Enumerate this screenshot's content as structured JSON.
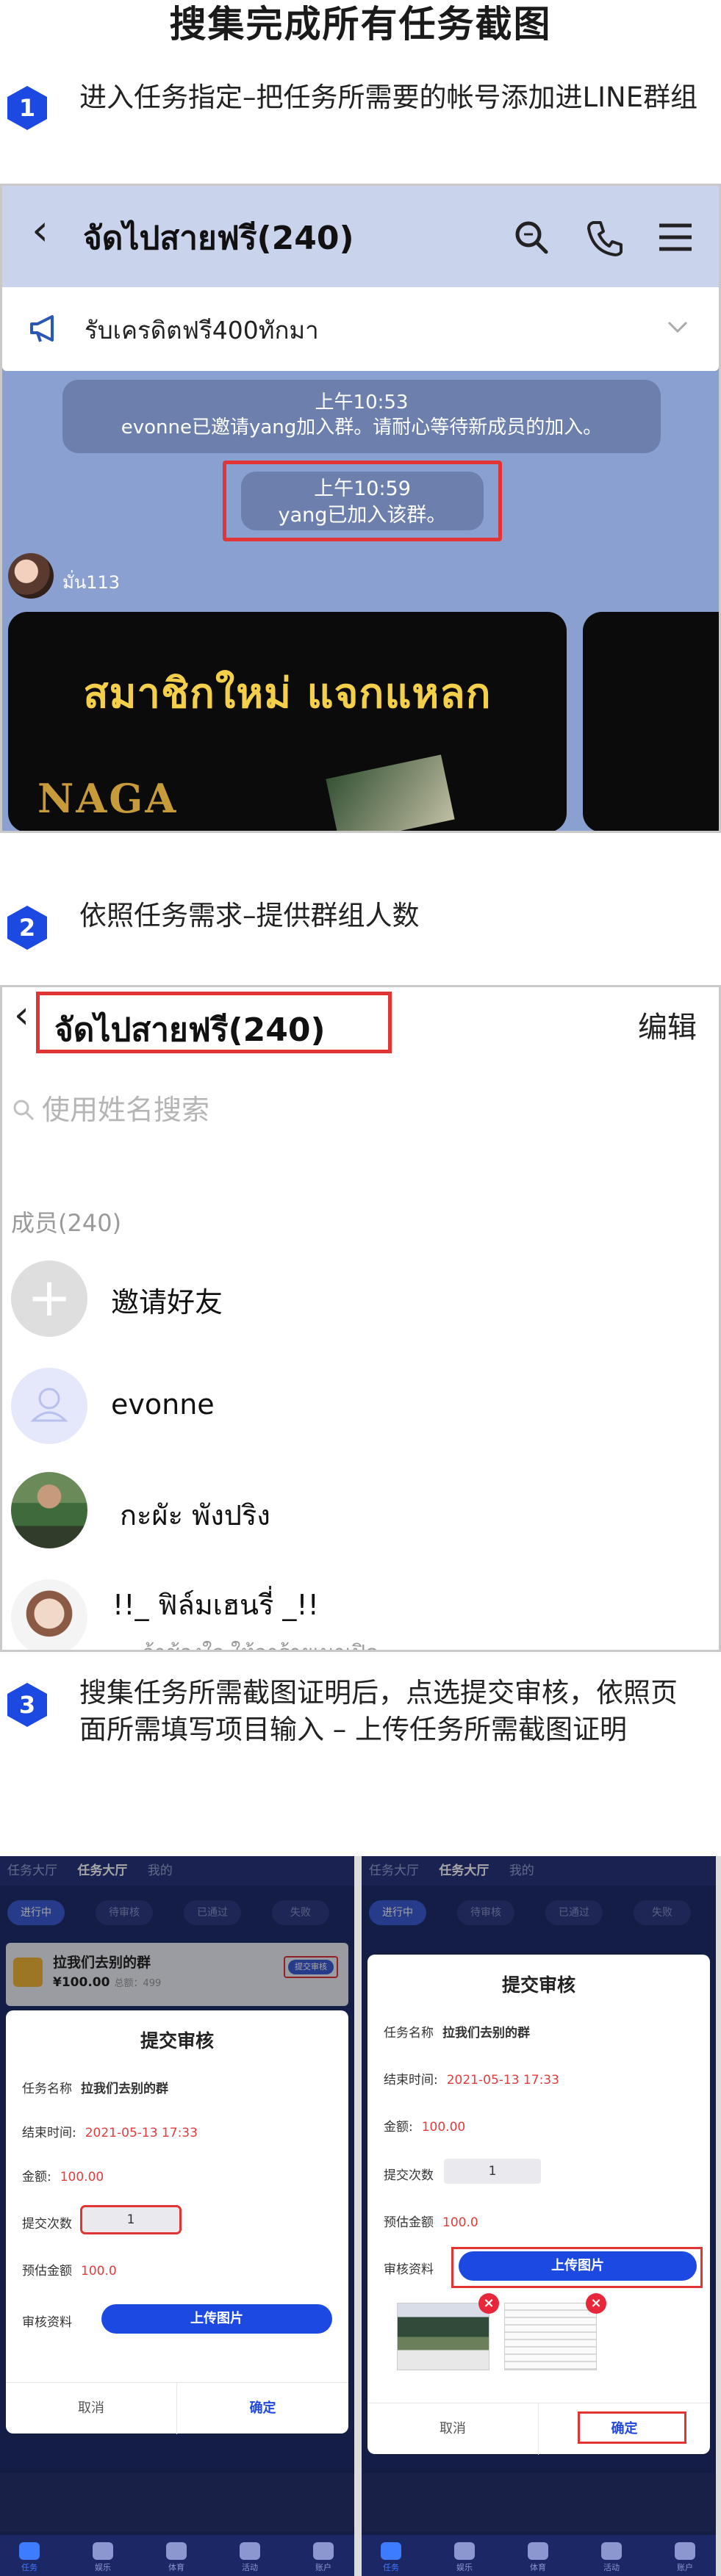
{
  "page_title": "搜集完成所有任务截图",
  "steps": [
    {
      "number": "1",
      "text": "进入任务指定–把任务所需要的帐号添加进LINE群组"
    },
    {
      "number": "2",
      "text": "依照任务需求–提供群组人数"
    },
    {
      "number": "3",
      "text": "搜集任务所需截图证明后，点选提交审核，依照页面所需填写项目输入 – 上传任务所需截图证明"
    }
  ],
  "colors": {
    "accent_blue": "#1d49e3",
    "highlight_red": "#e13434",
    "line_blue": "#8aa0d1"
  },
  "line_chat": {
    "title": "จัดไปสายฟรี(240)",
    "notice": "รับเครดิตฟรี400ทักมา",
    "sys_msg_1_time": "上午10:53",
    "sys_msg_1_text": "evonne已邀请yang加入群。请耐心等待新成员的加入。",
    "sys_msg_2_time": "上午10:59",
    "sys_msg_2_text": "yang已加入该群。",
    "sender": "มั่น113",
    "promo_text": "สมาชิกใหม่ แจกแหลก",
    "promo_logo": "NAGA"
  },
  "group_members": {
    "title": "จัดไปสายฟรี(240)",
    "edit_label": "编辑",
    "search_placeholder": "使用姓名搜索",
    "count_label": "成员(240)",
    "rows": [
      {
        "name": "邀请好友"
      },
      {
        "name": "evonne"
      },
      {
        "name": "กะผัะ พังปริง"
      },
      {
        "name": "!!_ ฟิล์มเฮนรี่ _!!",
        "sub": "ถ้าช้องใจ ให้อาร้ายเมาเปิด"
      }
    ]
  },
  "task_left": {
    "tabs": [
      "任务大厅",
      "我的"
    ],
    "topbar_left": "任务大厅",
    "filter_tabs": [
      "进行中",
      "待审核",
      "已通过",
      "失败"
    ],
    "card_title": "拉我们去别的群",
    "card_amount": "¥100.00",
    "card_sub": "总额：499",
    "card_button": "提交审核",
    "modal": {
      "title": "提交审核",
      "task_name_label": "任务名称",
      "task_name": "拉我们去别的群",
      "end_time_label": "结束时间:",
      "end_time": "2021-05-13 17:33",
      "amount_label": "金额:",
      "amount": "100.00",
      "submit_count_label": "提交次数",
      "submit_count": "1",
      "estimate_label": "预估金额",
      "estimate": "100.0",
      "material_label": "审核资料",
      "upload_label": "上传图片",
      "cancel": "取消",
      "confirm": "确定"
    },
    "nav": [
      "任务",
      "娱乐",
      "体育",
      "活动",
      "账户"
    ]
  },
  "task_right": {
    "topbar_left": "任务大厅",
    "topbar_items": [
      "任务大厅",
      "我的"
    ],
    "filter_tabs": [
      "进行中",
      "待审核",
      "已通过",
      "失败"
    ],
    "modal": {
      "title": "提交审核",
      "task_name_label": "任务名称",
      "task_name": "拉我们去别的群",
      "end_time_label": "结束时间:",
      "end_time": "2021-05-13 17:33",
      "amount_label": "金额:",
      "amount": "100.00",
      "submit_count_label": "提交次数",
      "submit_count": "1",
      "estimate_label": "预估金额",
      "estimate": "100.0",
      "material_label": "审核资料",
      "upload_label": "上传图片",
      "cancel": "取消",
      "confirm": "确定"
    },
    "nav": [
      "任务",
      "娱乐",
      "体育",
      "活动",
      "账户"
    ]
  }
}
